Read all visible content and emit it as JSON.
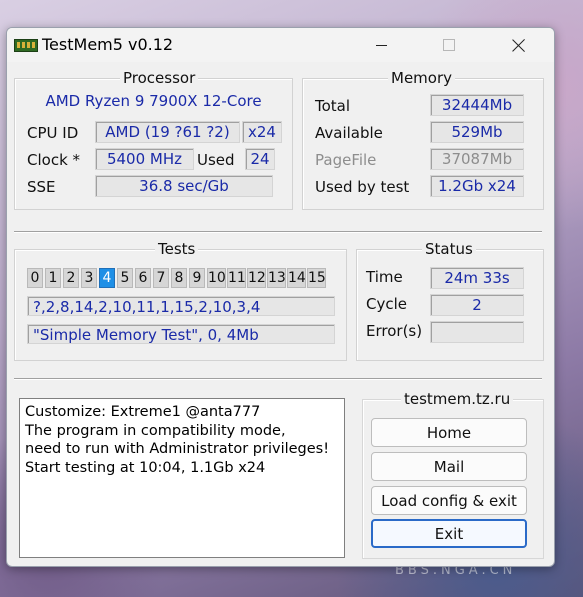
{
  "window": {
    "title": "TestMem5 v0.12"
  },
  "processor": {
    "heading": "Processor",
    "name": "AMD Ryzen 9 7900X 12-Core",
    "cpu_id_label": "CPU ID",
    "cpu_id_value": "AMD  (19 ?61 ?2)",
    "threads_value": "x24",
    "clock_label": "Clock *",
    "clock_value": "5400 MHz",
    "used_label": "Used",
    "used_value": "24",
    "sse_label": "SSE",
    "sse_value": "36.8 sec/Gb"
  },
  "memory": {
    "heading": "Memory",
    "total_label": "Total",
    "total_value": "32444Mb",
    "available_label": "Available",
    "available_value": "529Mb",
    "pagefile_label": "PageFile",
    "pagefile_value": "37087Mb",
    "used_by_test_label": "Used by test",
    "used_by_test_value": "1.2Gb x24"
  },
  "tests": {
    "heading": "Tests",
    "numbers": [
      "0",
      "1",
      "2",
      "3",
      "4",
      "5",
      "6",
      "7",
      "8",
      "9",
      "10",
      "11",
      "12",
      "13",
      "14",
      "15"
    ],
    "active_index": 4,
    "sequence": "?,2,8,14,2,10,11,1,15,2,10,3,4",
    "current": "\"Simple Memory Test\", 0, 4Mb"
  },
  "status": {
    "heading": "Status",
    "time_label": "Time",
    "time_value": "24m 33s",
    "cycle_label": "Cycle",
    "cycle_value": "2",
    "errors_label": "Error(s)",
    "errors_value": ""
  },
  "log": {
    "lines": [
      "Customize: Extreme1 @anta777",
      "The program in compatibility mode,",
      "need to run with Administrator privileges!",
      "Start testing at 10:04, 1.1Gb x24"
    ]
  },
  "links": {
    "heading": "testmem.tz.ru",
    "home_label": "Home",
    "mail_label": "Mail",
    "load_label": "Load config & exit",
    "exit_label": "Exit"
  },
  "background": {
    "watermark": "BBS.NGA.CN"
  }
}
